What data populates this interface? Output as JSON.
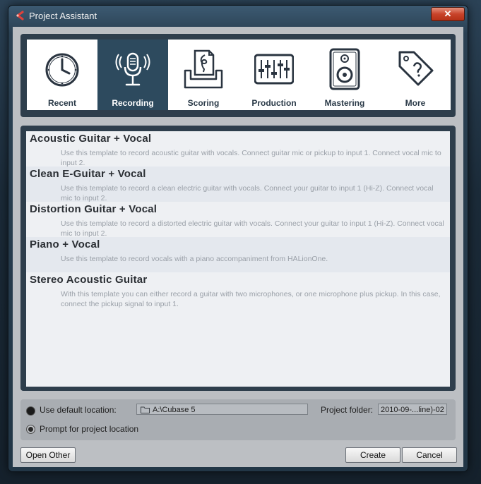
{
  "window": {
    "title": "Project Assistant",
    "close_glyph": "✕"
  },
  "tabs": [
    {
      "label": "Recent",
      "icon": "clock-icon"
    },
    {
      "label": "Recording",
      "icon": "microphone-icon",
      "active": true
    },
    {
      "label": "Scoring",
      "icon": "score-icon"
    },
    {
      "label": "Production",
      "icon": "mixer-icon"
    },
    {
      "label": "Mastering",
      "icon": "speaker-icon"
    },
    {
      "label": "More",
      "icon": "tag-icon"
    }
  ],
  "templates": [
    {
      "title": "Acoustic Guitar + Vocal",
      "description": "Use this template to record acoustic guitar with vocals. Connect guitar mic or pickup to input  1. Connect vocal mic to input 2."
    },
    {
      "title": "Clean E-Guitar + Vocal",
      "description": "Use this template to record a clean electric guitar with vocals. Connect your guitar to input  1 (Hi-Z). Connect vocal mic to input 2."
    },
    {
      "title": "Distortion Guitar + Vocal",
      "description": "Use this template to record a distorted electric guitar with vocals. Connect your guitar to input  1 (Hi-Z). Connect vocal mic to input 2."
    },
    {
      "title": "Piano + Vocal",
      "description": "Use this template to record vocals with a piano accompaniment from HALionOne."
    },
    {
      "title": "Stereo Acoustic Guitar",
      "description": "With this template you can either record a guitar with two microphones, or one microphone plus pickup. In this case, connect the pickup signal to input 1."
    }
  ],
  "location": {
    "default_label": "Use default location:",
    "default_path": "A:\\Cubase 5",
    "project_folder_label": "Project folder:",
    "project_folder_value": "2010-09-...line)-02",
    "prompt_label": "Prompt for project location",
    "selected": "prompt"
  },
  "buttons": {
    "open_other": "Open Other",
    "create": "Create",
    "cancel": "Cancel"
  },
  "colors": {
    "active_tab": "#2d4a5e",
    "close_button": "#c8432a"
  }
}
